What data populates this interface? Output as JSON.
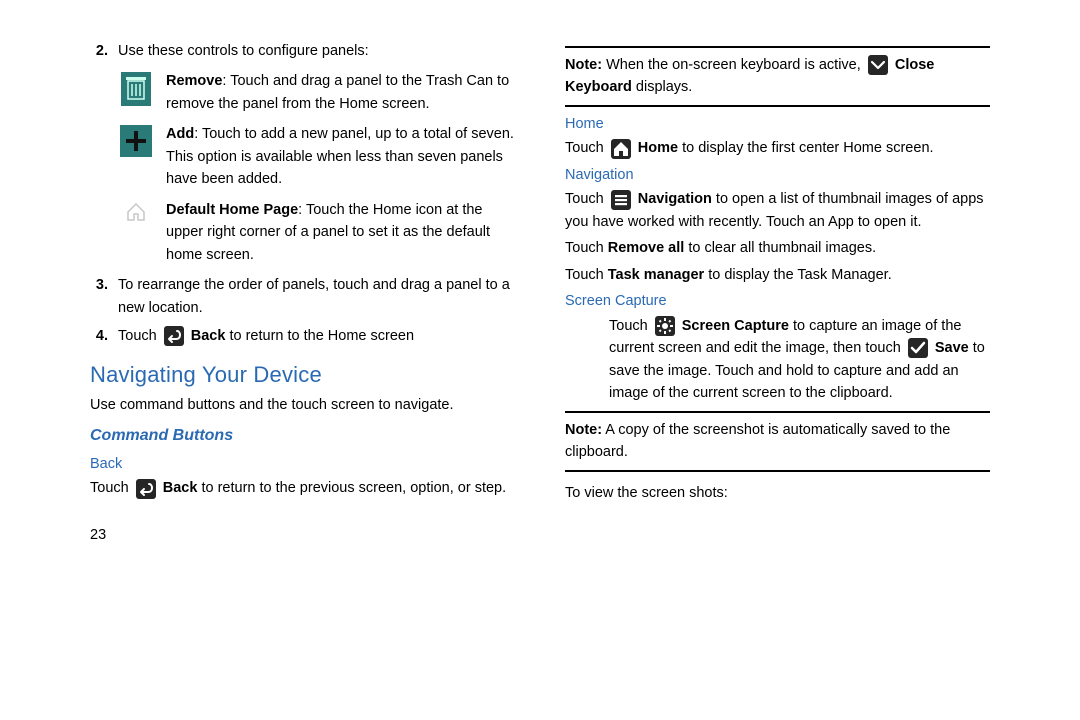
{
  "left": {
    "step2": {
      "num": "2.",
      "text": "Use these controls to configure panels:"
    },
    "remove": {
      "label": "Remove",
      "text": ": Touch and drag a panel to the Trash Can to remove the panel from the Home screen."
    },
    "add": {
      "label": "Add",
      "text": ": Touch to add a new panel, up to a total of seven. This option is available when less than seven panels have been added."
    },
    "default": {
      "label": "Default Home Page",
      "text": ": Touch the Home icon at the upper right corner of a panel to set it as the default home screen."
    },
    "step3": {
      "num": "3.",
      "text": "To rearrange the order of panels, touch and drag a panel to a new location."
    },
    "step4": {
      "num": "4.",
      "pre": "Touch ",
      "label": "Back",
      "post": " to return to the Home screen"
    },
    "h2": "Navigating Your Device",
    "intro": "Use command buttons and the touch screen to navigate.",
    "h3": "Command Buttons",
    "back_h4": "Back",
    "back_para_pre": "Touch ",
    "back_para_label": "Back",
    "back_para_post": " to return to the previous screen, option, or step.",
    "pagenum": "23"
  },
  "right": {
    "note1_label": "Note:",
    "note1_pre": " When the on-screen keyboard is active, ",
    "note1_close_label": "Close Keyboard",
    "note1_post": " displays.",
    "home_h4": "Home",
    "home_para_pre": "Touch ",
    "home_para_label": "Home",
    "home_para_post": " to display the first center Home screen.",
    "nav_h4": "Navigation",
    "nav_para_pre": "Touch ",
    "nav_para_label": "Navigation",
    "nav_para_post": " to open a list of thumbnail images of apps you have worked with recently. Touch an App to open it.",
    "removeall_pre": "Touch ",
    "removeall_label": "Remove all",
    "removeall_post": " to clear all thumbnail images.",
    "taskmgr_pre": "Touch ",
    "taskmgr_label": "Task manager",
    "taskmgr_post": " to display the Task Manager.",
    "capture_h4": "Screen Capture",
    "capture_pre": "Touch ",
    "capture_label": "Screen Capture",
    "capture_mid": " to capture an image of the current screen and edit the image, then touch ",
    "save_label": "Save",
    "capture_post": " to save the image. Touch and hold to capture and add an image of the current screen to the clipboard.",
    "note2_label": "Note:",
    "note2_text": " A copy of the screenshot is automatically saved to the clipboard.",
    "view_text": "To view the screen shots:"
  }
}
